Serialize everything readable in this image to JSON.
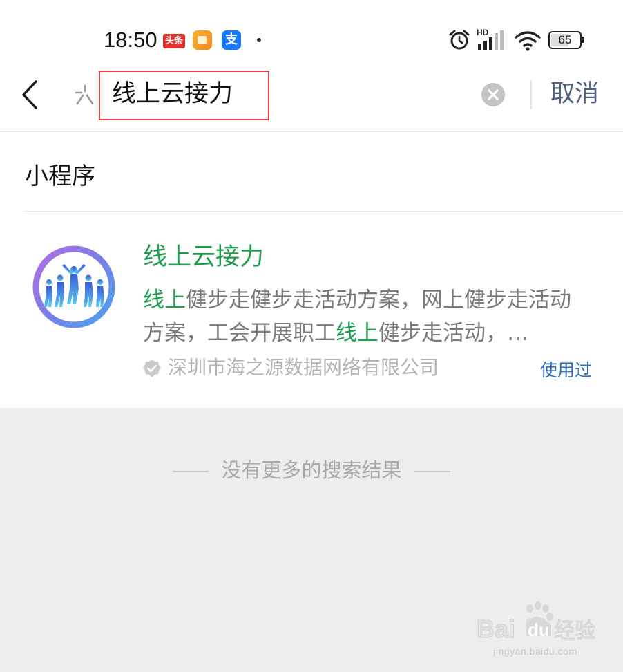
{
  "status_bar": {
    "time": "18:50",
    "toutiao_badge": "头条",
    "alipay_glyph": "支",
    "hd_label": "HD",
    "battery_level": "65"
  },
  "search": {
    "query": "线上云接力",
    "cancel_label": "取消"
  },
  "section": {
    "title": "小程序"
  },
  "result": {
    "title": "线上云接力",
    "desc_segments": [
      {
        "text": "线上",
        "highlight": true
      },
      {
        "text": "健步走健步走活动方案，网上健步走活动方案，工会开展职工",
        "highlight": false
      },
      {
        "text": "线上",
        "highlight": true
      },
      {
        "text": "健步走活动，…",
        "highlight": false
      }
    ],
    "company": "深圳市海之源数据网络有限公司",
    "used_label": "使用过"
  },
  "footer": {
    "no_more": "没有更多的搜索结果"
  },
  "watermark": {
    "brand": "Bai du 经验",
    "url": "jingyan.baidu.com"
  },
  "colors": {
    "highlight_green": "#1f9f4e",
    "cancel_blue": "#50607f",
    "used_blue": "#2f6fb5",
    "search_box_border": "#e2403e"
  }
}
